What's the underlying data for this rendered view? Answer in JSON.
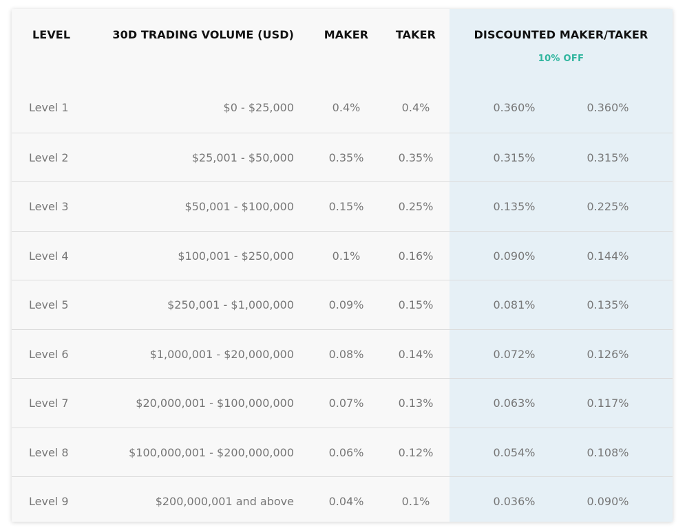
{
  "header": {
    "level": "LEVEL",
    "volume": "30D TRADING VOLUME (USD)",
    "maker": "MAKER",
    "taker": "TAKER",
    "discounted": "DISCOUNTED MAKER/TAKER",
    "discount_badge": "10% OFF"
  },
  "colors": {
    "accent_green": "#2fb59e",
    "discount_column_bg": "#e6f0f6",
    "table_bg": "#f8f8f8",
    "body_text": "#777777"
  },
  "rows": [
    {
      "level": "Level 1",
      "volume": "$0 - $25,000",
      "maker": "0.4%",
      "taker": "0.4%",
      "dmaker": "0.360%",
      "dtaker": "0.360%"
    },
    {
      "level": "Level 2",
      "volume": "$25,001 - $50,000",
      "maker": "0.35%",
      "taker": "0.35%",
      "dmaker": "0.315%",
      "dtaker": "0.315%"
    },
    {
      "level": "Level 3",
      "volume": "$50,001 - $100,000",
      "maker": "0.15%",
      "taker": "0.25%",
      "dmaker": "0.135%",
      "dtaker": "0.225%"
    },
    {
      "level": "Level 4",
      "volume": "$100,001 - $250,000",
      "maker": "0.1%",
      "taker": "0.16%",
      "dmaker": "0.090%",
      "dtaker": "0.144%"
    },
    {
      "level": "Level 5",
      "volume": "$250,001 - $1,000,000",
      "maker": "0.09%",
      "taker": "0.15%",
      "dmaker": "0.081%",
      "dtaker": "0.135%"
    },
    {
      "level": "Level 6",
      "volume": "$1,000,001 - $20,000,000",
      "maker": "0.08%",
      "taker": "0.14%",
      "dmaker": "0.072%",
      "dtaker": "0.126%"
    },
    {
      "level": "Level 7",
      "volume": "$20,000,001 - $100,000,000",
      "maker": "0.07%",
      "taker": "0.13%",
      "dmaker": "0.063%",
      "dtaker": "0.117%"
    },
    {
      "level": "Level 8",
      "volume": "$100,000,001 - $200,000,000",
      "maker": "0.06%",
      "taker": "0.12%",
      "dmaker": "0.054%",
      "dtaker": "0.108%"
    },
    {
      "level": "Level 9",
      "volume": "$200,000,001 and above",
      "maker": "0.04%",
      "taker": "0.1%",
      "dmaker": "0.036%",
      "dtaker": "0.090%"
    }
  ]
}
